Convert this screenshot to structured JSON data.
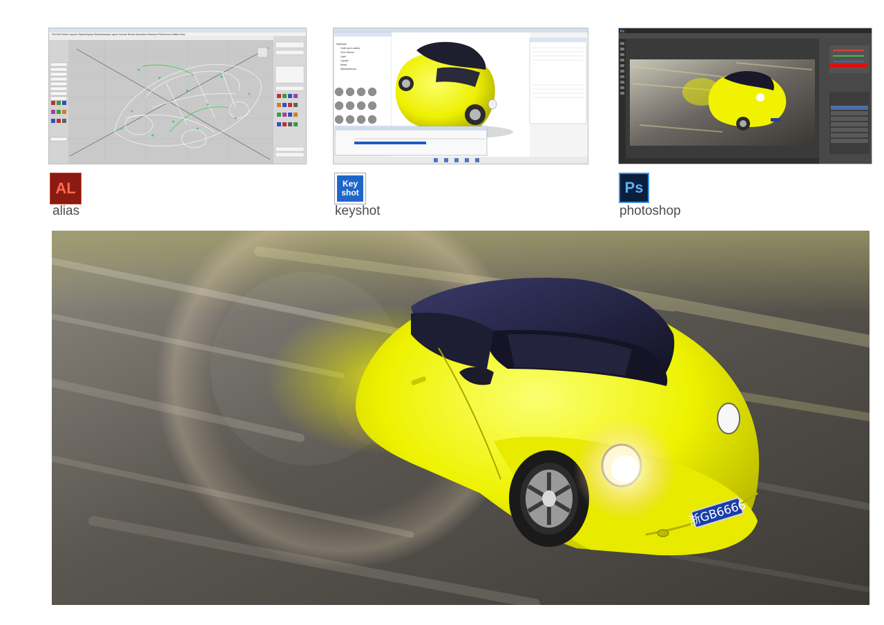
{
  "apps": [
    {
      "id": "alias",
      "icon_text": "AL",
      "label": "alias",
      "icon_color": "#8b1a12"
    },
    {
      "id": "keyshot",
      "icon_text_line1": "Key",
      "icon_text_line2": "shot",
      "label": "keyshot",
      "icon_color": "#1f66c9"
    },
    {
      "id": "photoshop",
      "icon_text": "Ps",
      "label": "photoshop",
      "icon_color": "#0b1f3a"
    }
  ],
  "screens": {
    "alias": {
      "menu": [
        "File",
        "Edit",
        "Delete",
        "Layouts",
        "ObjectDisplay",
        "WindowDisplay",
        "Layers",
        "Canvas",
        "Render",
        "Animation",
        "Windows",
        "Preferences",
        "Utilities",
        "Help"
      ]
    },
    "keyshot": {
      "library_items": [
        "Materials",
        "Cloth and Leather",
        "Gem Stones",
        "Light",
        "Liquids",
        "Metal",
        "Miscellaneous"
      ]
    },
    "photoshop": {
      "app_mark": "Ps"
    }
  },
  "hero": {
    "plate_text": "浙GB6666"
  },
  "colors": {
    "car_yellow": "#f2f20a",
    "roof": "#1a1a3a",
    "road": "#4f4a44",
    "background": "#ffffff"
  }
}
